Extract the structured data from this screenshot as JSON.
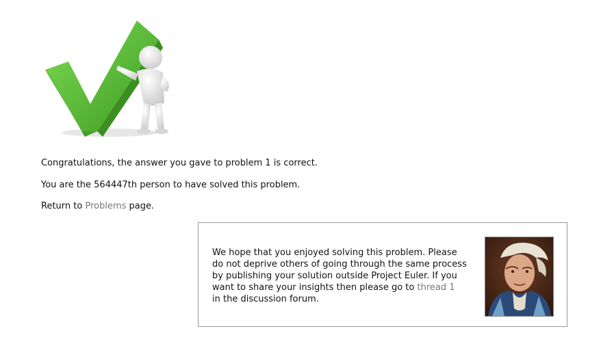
{
  "result": {
    "congrats": "Congratulations, the answer you gave to problem 1 is correct.",
    "solver_rank": "You are the 564447th person to have solved this problem.",
    "return_prefix": "Return to ",
    "return_link": "Problems",
    "return_suffix": " page."
  },
  "note": {
    "text": "We hope that you enjoyed solving this problem. Please\ndo not deprive others of going through the same process\nby publishing your solution outside Project Euler. If you\nwant to share your insights then please go to ",
    "link": "thread 1",
    "suffix": "\nin the discussion forum."
  },
  "colors": {
    "check_green": "#5ab93a",
    "link_gray": "#777777",
    "border": "#999999"
  },
  "icons": {
    "hero": "checkmark-figure-icon",
    "portrait": "euler-portrait"
  }
}
